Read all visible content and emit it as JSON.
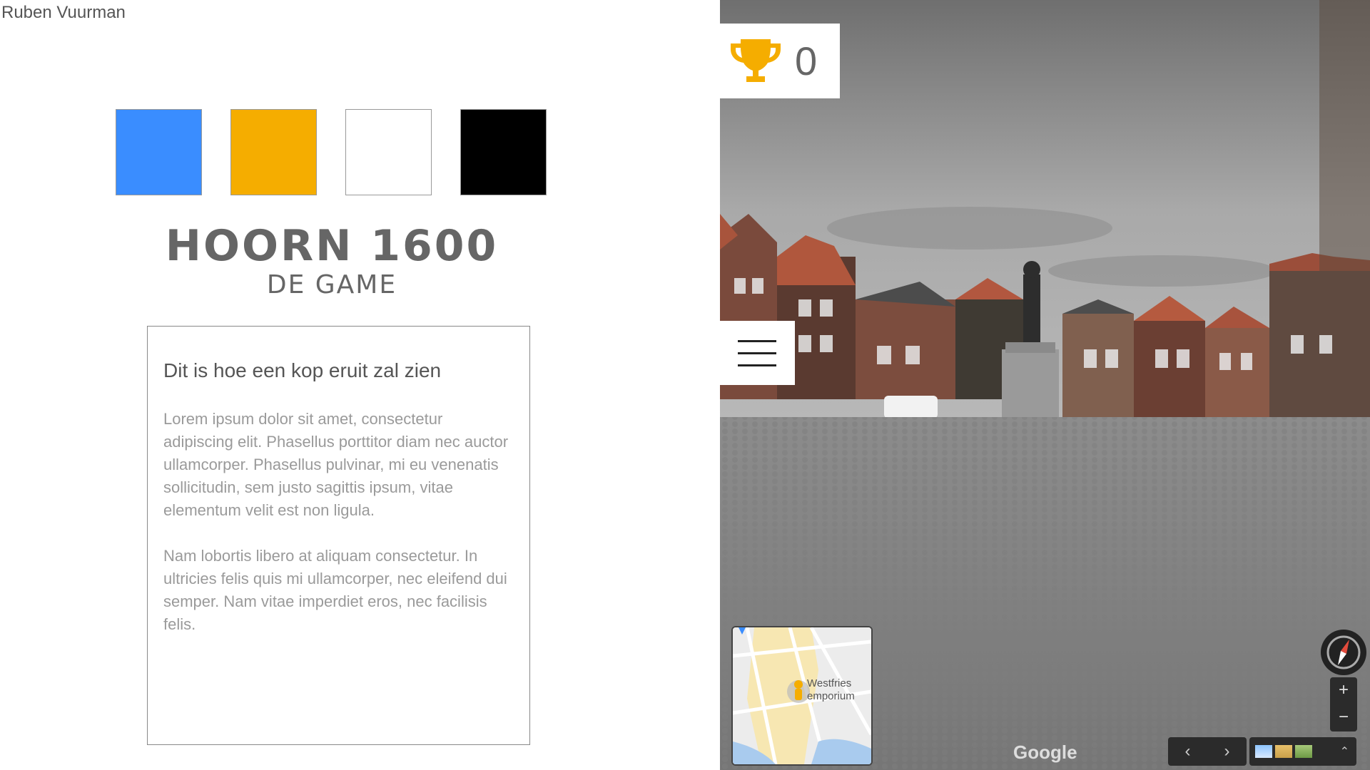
{
  "author": "Ruben Vuurman",
  "swatches": [
    {
      "name": "blue",
      "color": "#3A8DFF"
    },
    {
      "name": "orange",
      "color": "#F5AD00"
    },
    {
      "name": "white",
      "color": "#FFFFFF"
    },
    {
      "name": "black",
      "color": "#000000"
    }
  ],
  "title": {
    "main": "HOORN 1600",
    "sub": "DE GAME"
  },
  "card": {
    "heading": "Dit is hoe een kop eruit zal zien",
    "paragraph1": "Lorem ipsum dolor sit amet, consectetur adipiscing elit. Phasellus porttitor diam nec auctor ullamcorper. Phasellus pulvinar, mi eu venenatis sollicitudin, sem justo sagittis ipsum, vitae elementum velit est non ligula.",
    "paragraph2": "Nam lobortis libero at aliquam consectetur. In ultricies felis quis mi ullamcorper, nec eleifend dui semper. Nam vitae imperdiet eros, nec facilisis felis."
  },
  "score": {
    "value": "0",
    "icon": "trophy-icon"
  },
  "menu": {
    "icon": "hamburger-menu-icon"
  },
  "streetview": {
    "minimap_label": "Westfries emporium",
    "google_label": "Google",
    "zoom_in": "+",
    "zoom_out": "−",
    "prev": "‹",
    "next": "›",
    "expand": "⌃"
  },
  "colors": {
    "accent": "#F5AD00",
    "text_dark": "#555555",
    "text_muted": "#9a9a9a"
  }
}
